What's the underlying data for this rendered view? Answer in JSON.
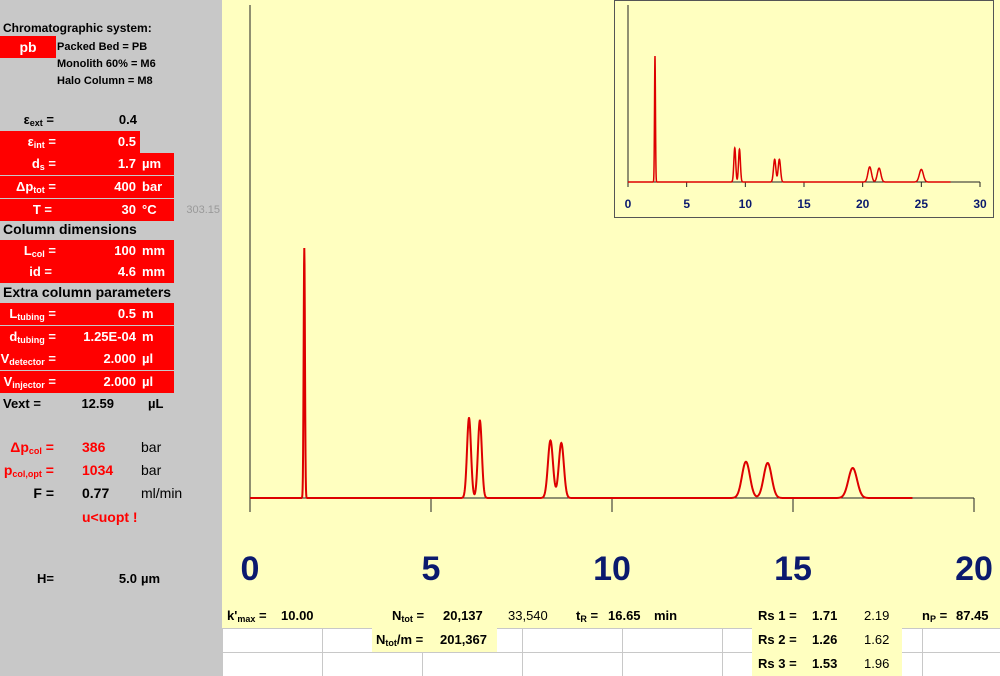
{
  "colors": {
    "accent_red": "#ff0000",
    "chart_bg": "#ffffc0",
    "trace": "#dd0000",
    "axis_label": "#0b1a6e"
  },
  "sidebar": {
    "system_title": "Chromatographic system:",
    "system_code": "pb",
    "options": [
      "Packed Bed = PB",
      "Monolith 60% = M6",
      "Halo Column = M8"
    ],
    "eps_ext_label": "ε",
    "eps_ext_sub": "ext",
    "eps_ext_value": "0.4",
    "eps_int_label": "ε",
    "eps_int_sub": "int",
    "eps_int_value": "0.5",
    "ds_label": "d",
    "ds_sub": "s",
    "ds_value": "1.7",
    "ds_unit": "µm",
    "dp_label": "Δp",
    "dp_sub": "tot",
    "dp_value": "400",
    "dp_unit": "bar",
    "t_label": "T =",
    "t_value": "30",
    "t_unit": "°C",
    "t_kelvin": "303.15",
    "col_dim_title": "Column dimensions",
    "lcol_label": "L",
    "lcol_sub": "col",
    "lcol_value": "100",
    "lcol_unit": "mm",
    "id_label": "id =",
    "id_value": "4.6",
    "id_unit": "mm",
    "extra_title": "Extra column parameters",
    "ltub_label": "L",
    "ltub_sub": "tubing",
    "ltub_value": "0.5",
    "ltub_unit": "m",
    "dtub_label": "d",
    "dtub_sub": "tubing",
    "dtub_value": "1.25E-04",
    "dtub_unit": "m",
    "vdet_label": "V",
    "vdet_sub": "detector",
    "vdet_value": "2.000",
    "vdet_unit": "µl",
    "vinj_label": "V",
    "vinj_sub": "injector",
    "vinj_value": "2.000",
    "vinj_unit": "µl",
    "vext_label": "Vext =",
    "vext_value": "12.59",
    "vext_unit": "µL",
    "dpcol_label": "Δp",
    "dpcol_sub": "col",
    "dpcol_value": "386",
    "dpcol_unit": "bar",
    "pcolopt_label": "p",
    "pcolopt_sub": "col,opt",
    "pcolopt_value": "1034",
    "pcolopt_unit": "bar",
    "f_label": "F =",
    "f_value": "0.77",
    "f_unit": "ml/min",
    "warning": "u<uopt !",
    "h_label": "H=",
    "h_value": "5.0",
    "h_unit": "µm"
  },
  "results": {
    "kmax_label": "k'",
    "kmax_sub": "max",
    "kmax_value": "10.00",
    "ntot_label": "N",
    "ntot_sub": "tot",
    "ntot_value": "20,137",
    "ntot_alt": "33,540",
    "ntotm_label": "N",
    "ntotm_sub": "tot",
    "ntotm_suffix": "/m =",
    "ntotm_value": "201,367",
    "tr_label": "t",
    "tr_sub": "R",
    "tr_value": "16.65",
    "tr_unit": "min",
    "rs": [
      {
        "label": "Rs 1 =",
        "value": "1.71",
        "alt": "2.19"
      },
      {
        "label": "Rs 2 =",
        "value": "1.26",
        "alt": "1.62"
      },
      {
        "label": "Rs 3 =",
        "value": "1.53",
        "alt": "1.96"
      }
    ],
    "np_label": "n",
    "np_sub": "P",
    "np_value": "87.45"
  },
  "chart_data": [
    {
      "type": "line",
      "title": "",
      "xlim": [
        0,
        20
      ],
      "xticks": [
        "0",
        "5",
        "10",
        "15",
        "20"
      ],
      "peaks": [
        {
          "t": 1.5,
          "h": 1.0,
          "w": 0.018
        },
        {
          "t": 6.05,
          "h": 0.32,
          "w": 0.055
        },
        {
          "t": 6.35,
          "h": 0.31,
          "w": 0.055
        },
        {
          "t": 8.3,
          "h": 0.23,
          "w": 0.07
        },
        {
          "t": 8.6,
          "h": 0.22,
          "w": 0.07
        },
        {
          "t": 13.7,
          "h": 0.145,
          "w": 0.11
        },
        {
          "t": 14.3,
          "h": 0.14,
          "w": 0.11
        },
        {
          "t": 16.65,
          "h": 0.12,
          "w": 0.12
        }
      ],
      "x_end": 18.3
    },
    {
      "type": "line",
      "title": "",
      "xlim": [
        0,
        30
      ],
      "xticks": [
        "0",
        "5",
        "10",
        "15",
        "20",
        "25",
        "30"
      ],
      "peaks": [
        {
          "t": 2.3,
          "h": 1.0,
          "w": 0.04
        },
        {
          "t": 9.1,
          "h": 0.27,
          "w": 0.08
        },
        {
          "t": 9.5,
          "h": 0.26,
          "w": 0.08
        },
        {
          "t": 12.5,
          "h": 0.18,
          "w": 0.1
        },
        {
          "t": 12.9,
          "h": 0.18,
          "w": 0.1
        },
        {
          "t": 20.6,
          "h": 0.12,
          "w": 0.15
        },
        {
          "t": 21.4,
          "h": 0.11,
          "w": 0.15
        },
        {
          "t": 25.0,
          "h": 0.1,
          "w": 0.17
        }
      ],
      "x_end": 27.5
    }
  ]
}
